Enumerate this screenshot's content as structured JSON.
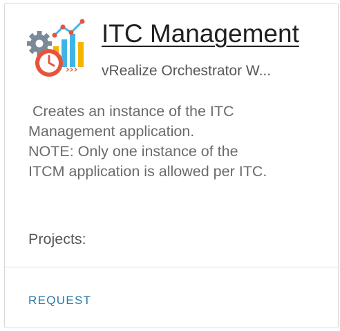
{
  "card": {
    "title": "ITC Management",
    "subtitle": "vRealize Orchestrator W...",
    "icon": "analytics-gear-clock-icon",
    "description_lines": [
      " Creates an instance of the ITC",
      "Management application.",
      "NOTE: Only one instance of the",
      "ITCM application is allowed per ITC."
    ],
    "projects_label": "Projects:",
    "request_label": "REQUEST"
  },
  "colors": {
    "link": "#2a78a8",
    "title": "#1f1f1f",
    "description": "#6b6b6b",
    "border": "#d8d8d8"
  }
}
